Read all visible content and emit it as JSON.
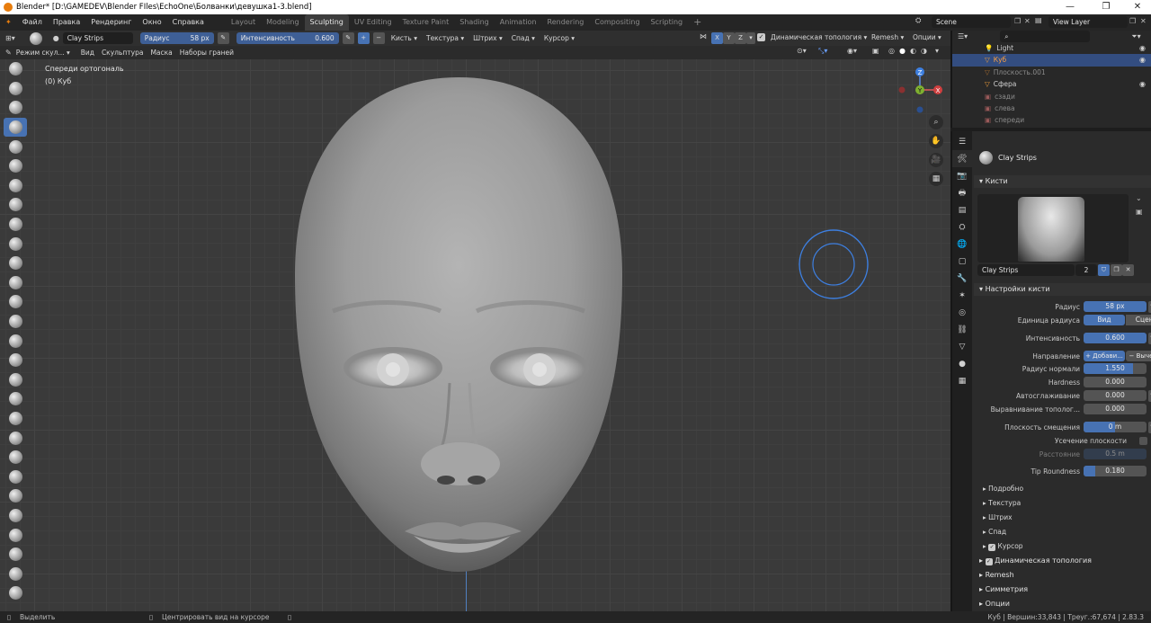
{
  "window": {
    "title": "Blender* [D:\\GAMEDEV\\Blender FIles\\EchoOne\\Болванки\\девушка1-3.blend]"
  },
  "menu": [
    "Файл",
    "Правка",
    "Рендеринг",
    "Окно",
    "Справка"
  ],
  "workspaces": [
    "Layout",
    "Modeling",
    "Sculpting",
    "UV Editing",
    "Texture Paint",
    "Shading",
    "Animation",
    "Rendering",
    "Compositing",
    "Scripting"
  ],
  "active_workspace": "Sculpting",
  "scene": {
    "name": "Scene",
    "view_layer": "View Layer"
  },
  "tool_header": {
    "brush_name": "Clay Strips",
    "radius_label": "Радиус",
    "radius_value": "58 px",
    "strength_label": "Интенсивность",
    "strength_value": "0.600",
    "menus": [
      "Кисть",
      "Текстура",
      "Штрих",
      "Спад",
      "Курсор"
    ],
    "axes": [
      "X",
      "Y",
      "Z"
    ],
    "dyntopo_label": "Динамическая топология",
    "remesh_label": "Remesh",
    "options_label": "Опции"
  },
  "view_header": {
    "mode": "Режим скул...",
    "menus": [
      "Вид",
      "Скульптура",
      "Маска",
      "Наборы граней"
    ]
  },
  "viewport": {
    "view_name": "Спереди ортогональ",
    "object_label": "(0) Куб",
    "gizmo": {
      "z": "Z",
      "y": "Y",
      "x": "X"
    }
  },
  "outliner": {
    "items": [
      {
        "name": "Light",
        "selected": false,
        "visible": true
      },
      {
        "name": "Куб",
        "selected": true,
        "visible": true
      },
      {
        "name": "Плоскость.001",
        "selected": false,
        "visible": false
      },
      {
        "name": "Сфера",
        "selected": false,
        "visible": true
      },
      {
        "name": "сзади",
        "selected": false,
        "visible": false
      },
      {
        "name": "слева",
        "selected": false,
        "visible": false
      },
      {
        "name": "спереди",
        "selected": false,
        "visible": false
      }
    ]
  },
  "properties": {
    "tool_name": "Clay Strips",
    "brushes_panel": "Кисти",
    "brush_field": "Clay Strips",
    "brush_users": "2",
    "settings_panel": "Настройки кисти",
    "radius": {
      "label": "Радиус",
      "value": "58 px"
    },
    "radius_unit": {
      "label": "Единица радиуса",
      "options": [
        "Вид",
        "Сцена"
      ],
      "selected": "Вид"
    },
    "strength": {
      "label": "Интенсивность",
      "value": "0.600",
      "fill": 0.6
    },
    "direction": {
      "label": "Направление",
      "add": "+ Добави...",
      "subtract": "− Вычесть"
    },
    "normal_radius": {
      "label": "Радиус нормали",
      "value": "1.550",
      "fill": 0.78
    },
    "hardness": {
      "label": "Hardness",
      "value": "0.000",
      "fill": 0
    },
    "autosmooth": {
      "label": "Автосглаживание",
      "value": "0.000",
      "fill": 0
    },
    "topology_rake": {
      "label": "Выравнивание тополог...",
      "value": "0.000",
      "fill": 0
    },
    "plane_offset": {
      "label": "Плоскость смещения",
      "value": "0 m",
      "fill": 0.5
    },
    "plane_trim": {
      "label": "Усечение плоскости"
    },
    "distance": {
      "label": "Расстояние",
      "value": "0.5 m"
    },
    "tip_roundness": {
      "label": "Tip Roundness",
      "value": "0.180",
      "fill": 0.18
    },
    "subpanels": [
      "Подробно",
      "Текстура",
      "Штрих",
      "Спад",
      "Курсор"
    ],
    "sections": [
      "Динамическая топология",
      "Remesh",
      "Симметрия",
      "Опции"
    ]
  },
  "statusbar": {
    "select": "Выделить",
    "center": "Центрировать вид на курсоре",
    "stats": "Куб | Вершин:33,843 | Треуг.:67,674 | 2.83.3"
  },
  "colors": {
    "accent": "#4772b3",
    "selection": "#334d80",
    "viewport_bg": "#3a3a3a"
  }
}
